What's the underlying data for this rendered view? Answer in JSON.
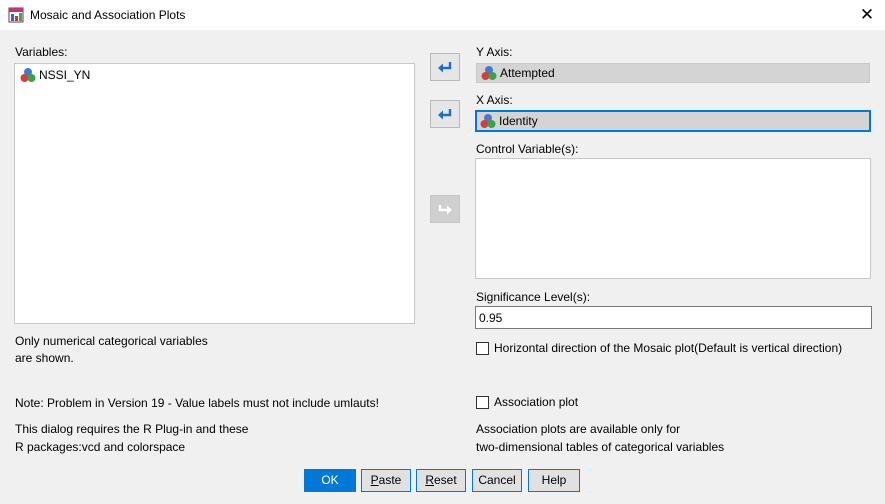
{
  "window": {
    "title": "Mosaic and Association Plots",
    "close_label": "✕"
  },
  "variables": {
    "label": "Variables:",
    "items": [
      "NSSI_YN"
    ]
  },
  "note_numerical": {
    "line1": "Only numerical categorical variables",
    "line2": "are shown."
  },
  "note_version": "Note: Problem in Version 19 - Value labels must not include umlauts!",
  "note_r": {
    "line1": "This dialog requires the R Plug-in and these",
    "line2": "R packages:vcd and colorspace"
  },
  "y_axis": {
    "label": "Y Axis:",
    "value": "Attempted"
  },
  "x_axis": {
    "label": "X Axis:",
    "value": "Identity"
  },
  "control": {
    "label": "Control Variable(s):"
  },
  "significance": {
    "label": "Significance Level(s):",
    "value": "0.95"
  },
  "horizontal_check": {
    "label": "Horizontal direction of the Mosaic plot(Default is vertical direction)",
    "checked": false
  },
  "association_check": {
    "label": "Association plot",
    "checked": false
  },
  "association_note": {
    "line1": "Association plots are available only for",
    "line2": "two-dimensional tables of categorical variables"
  },
  "buttons": {
    "ok": "OK",
    "paste_mnemonic": "P",
    "paste_rest": "aste",
    "reset_mnemonic": "R",
    "reset_rest": "eset",
    "cancel": "Cancel",
    "help": "Help"
  },
  "icons": {
    "app": "spss-dialog-icon",
    "variable": "nominal-variable-icon",
    "move_right": "move-arrow-icon",
    "move_left": "move-back-arrow-icon"
  },
  "colors": {
    "accent": "#0078d7",
    "dialog_bg": "#f0f0f0",
    "selected_field": "#d4d4d4"
  }
}
